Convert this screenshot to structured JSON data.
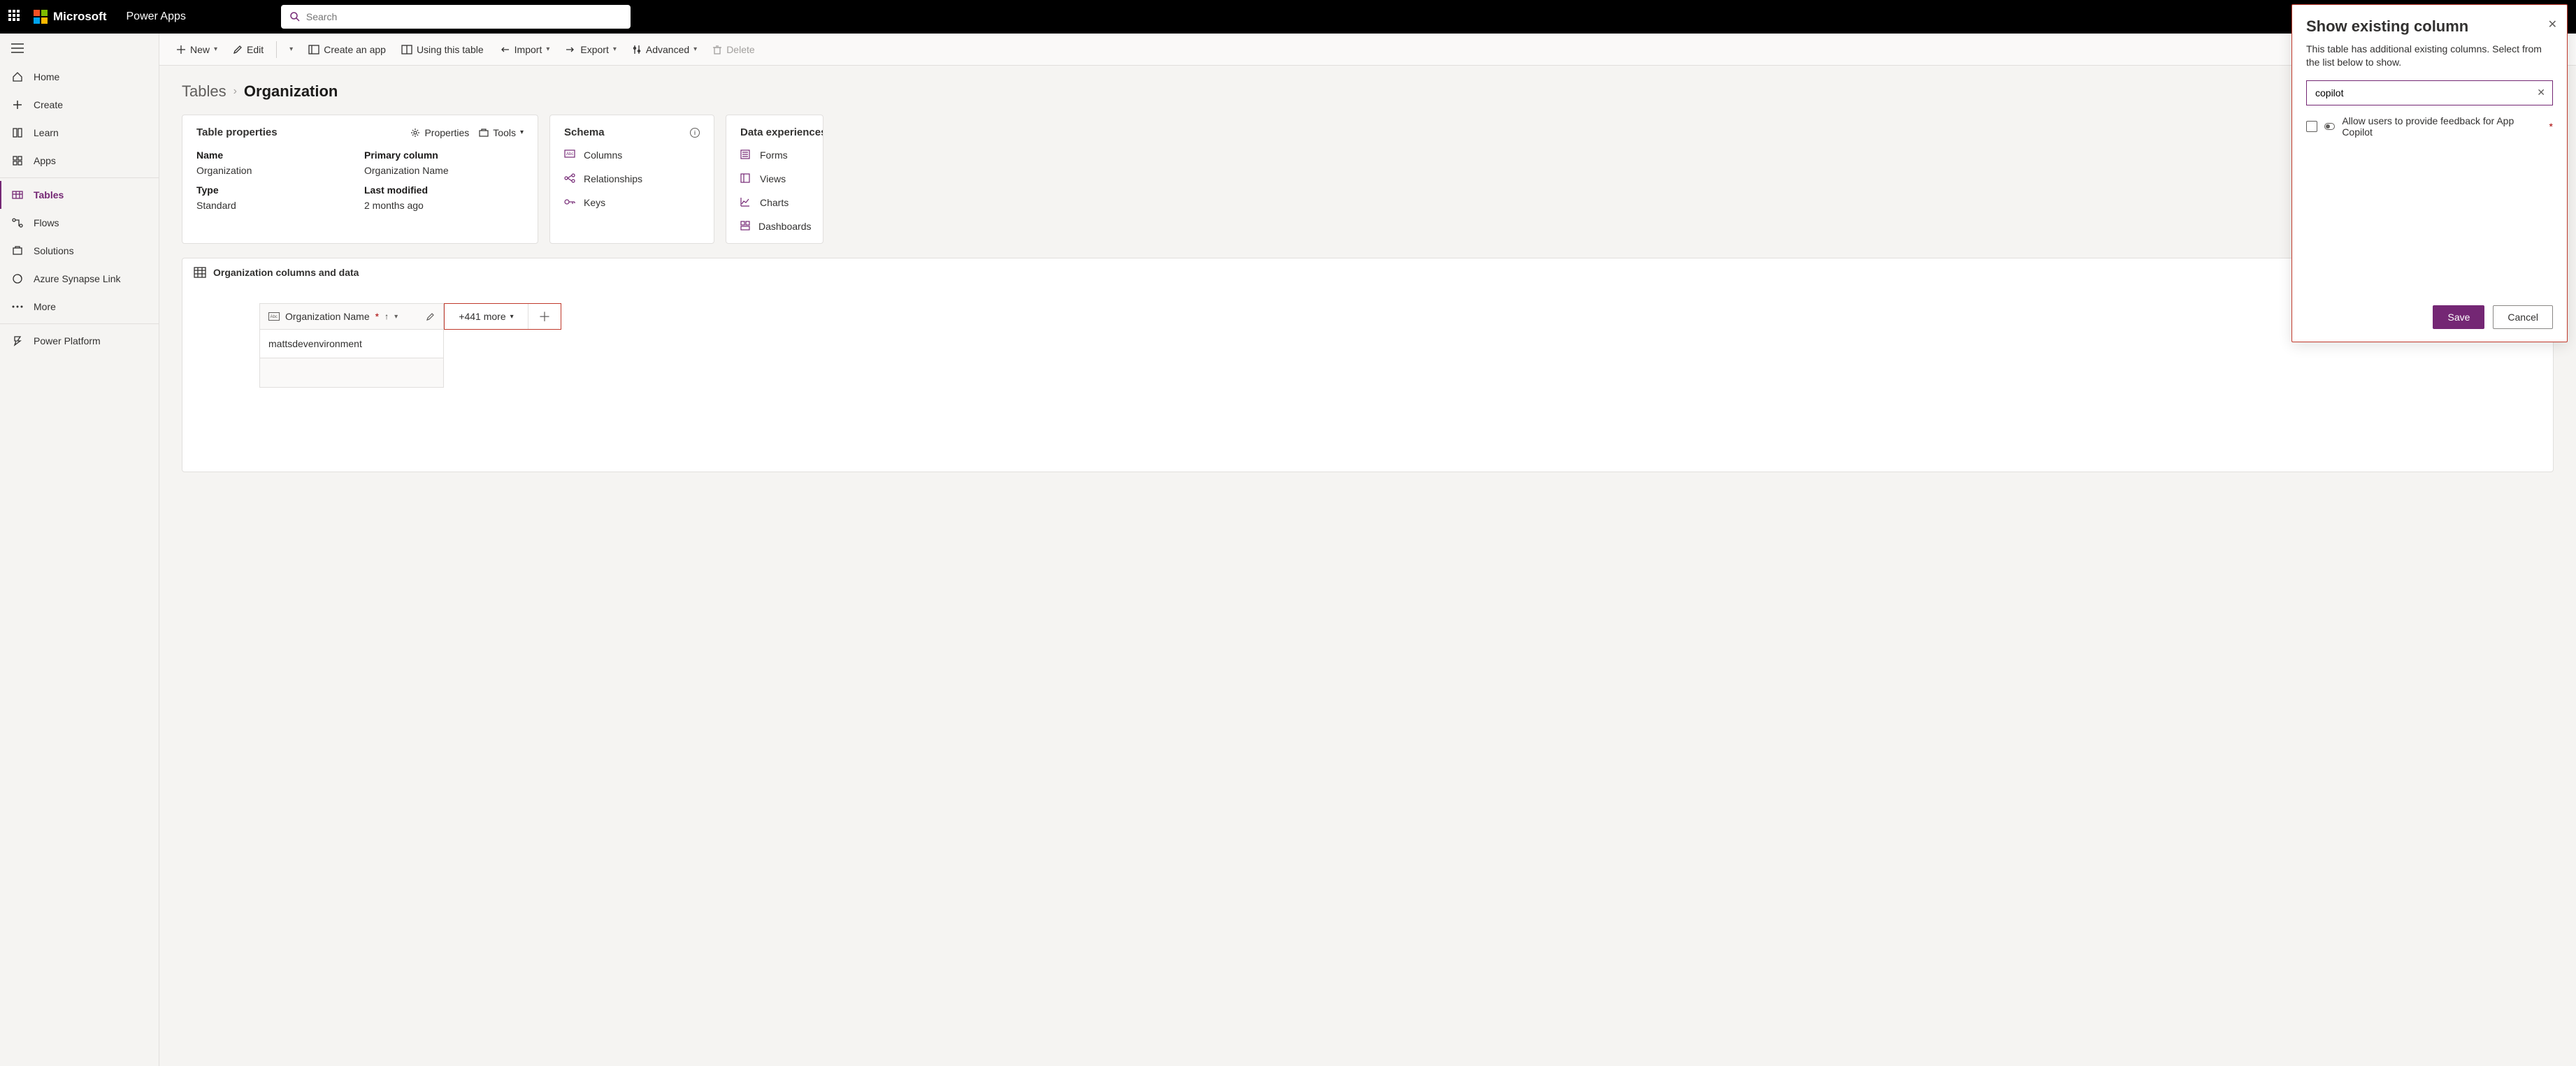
{
  "topbar": {
    "brand": "Microsoft",
    "app_name": "Power Apps",
    "search_placeholder": "Search"
  },
  "leftnav": {
    "home": "Home",
    "create": "Create",
    "learn": "Learn",
    "apps": "Apps",
    "tables": "Tables",
    "flows": "Flows",
    "solutions": "Solutions",
    "synapse": "Azure Synapse Link",
    "more": "More",
    "powerplatform": "Power Platform"
  },
  "cmdbar": {
    "new": "New",
    "edit": "Edit",
    "create_app": "Create an app",
    "using_table": "Using this table",
    "import": "Import",
    "export": "Export",
    "advanced": "Advanced",
    "delete": "Delete"
  },
  "breadcrumb": {
    "parent": "Tables",
    "current": "Organization"
  },
  "props_card": {
    "title": "Table properties",
    "properties_btn": "Properties",
    "tools_btn": "Tools",
    "name_label": "Name",
    "name_value": "Organization",
    "primary_col_label": "Primary column",
    "primary_col_value": "Organization Name",
    "type_label": "Type",
    "type_value": "Standard",
    "modified_label": "Last modified",
    "modified_value": "2 months ago"
  },
  "schema_card": {
    "title": "Schema",
    "columns": "Columns",
    "relationships": "Relationships",
    "keys": "Keys"
  },
  "dexp_card": {
    "title": "Data experiences",
    "forms": "Forms",
    "views": "Views",
    "charts": "Charts",
    "dashboards": "Dashboards"
  },
  "data_section": {
    "title": "Organization columns and data",
    "col_header": "Organization Name",
    "more_label": "+441 more",
    "row_value": "mattsdevenvironment"
  },
  "panel": {
    "title": "Show existing column",
    "desc": "This table has additional existing columns. Select from the list below to show.",
    "search_value": "copilot",
    "option_label": "Allow users to provide feedback for App Copilot",
    "save": "Save",
    "cancel": "Cancel"
  }
}
